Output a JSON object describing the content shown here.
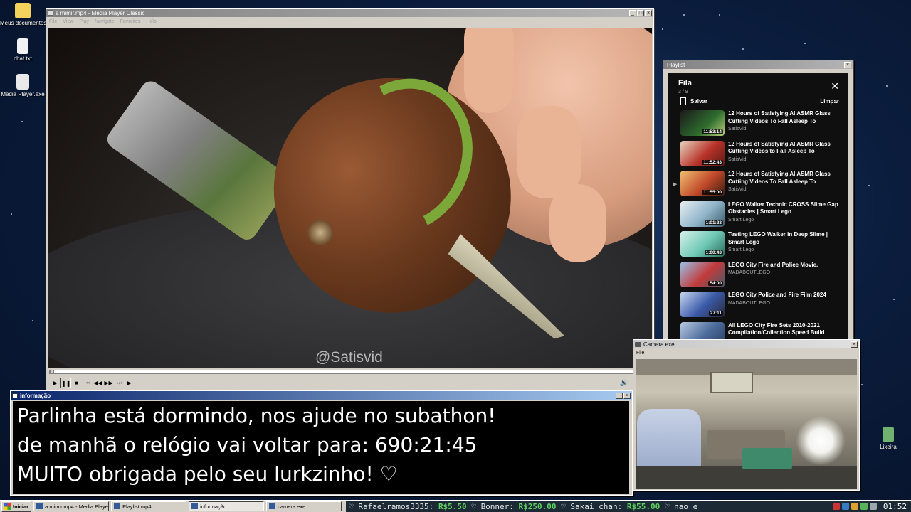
{
  "desktop_icons": [
    {
      "label": "Meus documentos",
      "color": "#f3d35c"
    },
    {
      "label": "chat.txt",
      "color": "#f2f2f2"
    },
    {
      "label": "Media Player.exe",
      "color": "#e9e9e9"
    },
    {
      "label": "Lixeira",
      "color": "#6fb36f"
    }
  ],
  "player": {
    "title": "a mimir.mp4 - Media Player Classic",
    "menu": [
      "File",
      "View",
      "Play",
      "Navigate",
      "Favorites",
      "Help"
    ],
    "watermark": "@Satisvid",
    "seek_position": 0.0,
    "controls": [
      "play",
      "pause",
      "stop",
      "prev",
      "rewind",
      "forward",
      "next",
      "frame-step",
      "volume"
    ]
  },
  "playlist": {
    "window_title": "Playlist",
    "heading": "Fila",
    "count": "3 / 9",
    "save_label": "Salvar",
    "clear_label": "Limpar",
    "current_index": 2,
    "items": [
      {
        "title": "12 Hours of Satisfying AI ASMR Glass Cutting Videos To Fall Asleep To",
        "channel": "SatisVid",
        "duration": "11:53:14",
        "thumb": "#2f6d2f"
      },
      {
        "title": "12 Hours of Satisfying AI ASMR Glass Cutting Videos to Fall Asleep To",
        "channel": "SatisVid",
        "duration": "11:52:43",
        "thumb": "#b8332a"
      },
      {
        "title": "12 Hours of Satisfying AI ASMR Glass Cutting Videos To Fall Asleep To",
        "channel": "SatisVid",
        "duration": "11:55:00",
        "thumb": "#c0492a"
      },
      {
        "title": "LEGO Walker Technic CROSS Slime Gap Obstacles | Smart Lego",
        "channel": "Smart Lego",
        "duration": "1:01:23",
        "thumb": "#8fb4c9"
      },
      {
        "title": "Testing LEGO Walker in Deep Slime | Smart Lego",
        "channel": "Smart Lego",
        "duration": "1:00:43",
        "thumb": "#6ec9b4"
      },
      {
        "title": "LEGO City Fire and Police Movie.",
        "channel": "MADABOUTLEGO",
        "duration": "54:00",
        "thumb": "#c23a3a"
      },
      {
        "title": "LEGO City Police and Fire Film 2024",
        "channel": "MADABOUTLEGO",
        "duration": "27:11",
        "thumb": "#3a5aa8"
      },
      {
        "title": "All LEGO City Fire Sets 2010-2021 Compilation/Collection Speed Build",
        "channel": "",
        "duration": "",
        "thumb": "#4a6a9a"
      }
    ]
  },
  "info": {
    "window_title": "informação",
    "line1": "Parlinha está dormindo, nos ajude no subathon!",
    "line2": "de manhã o relógio vai voltar para:  690:21:45",
    "line3": "MUITO obrigada pelo seu lurkzinho! ♡"
  },
  "camera": {
    "window_title": "Camera.exe",
    "menu_file": "File"
  },
  "taskbar": {
    "start_label": "Iniciar",
    "tasks": [
      {
        "label": "a mimir.mp4 - Media Playe...",
        "active": false
      },
      {
        "label": "Playlist.mp4",
        "active": false
      },
      {
        "label": "informação",
        "active": true
      },
      {
        "label": "camera.exe",
        "active": false
      }
    ],
    "ticker": [
      {
        "name": "Rafaelramos3335:",
        "amount": "R$5.50"
      },
      {
        "name": "Bonner:",
        "amount": "R$250.00"
      },
      {
        "name": "Sakai chan:",
        "amount": "R$55.00"
      },
      {
        "name": "nao e",
        "amount": ""
      }
    ],
    "clock": "01:52"
  }
}
